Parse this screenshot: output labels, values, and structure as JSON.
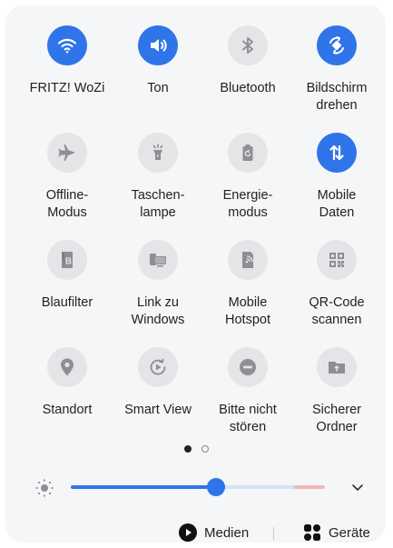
{
  "tiles": [
    {
      "label": "FRITZ! WoZi",
      "icon": "wifi-icon",
      "state": "on"
    },
    {
      "label": "Ton",
      "icon": "sound-icon",
      "state": "on"
    },
    {
      "label": "Bluetooth",
      "icon": "bluetooth-icon",
      "state": "off"
    },
    {
      "label": "Bildschirm\ndrehen",
      "icon": "auto-rotate-icon",
      "state": "on"
    },
    {
      "label": "Offline-\nModus",
      "icon": "airplane-icon",
      "state": "off"
    },
    {
      "label": "Taschen-\nlampe",
      "icon": "flashlight-icon",
      "state": "off"
    },
    {
      "label": "Energie-\nmodus",
      "icon": "power-saving-icon",
      "state": "off"
    },
    {
      "label": "Mobile\nDaten",
      "icon": "mobile-data-icon",
      "state": "on"
    },
    {
      "label": "Blaufilter",
      "icon": "blue-light-filter-icon",
      "state": "off"
    },
    {
      "label": "Link zu\nWindows",
      "icon": "link-to-windows-icon",
      "state": "off"
    },
    {
      "label": "Mobile\nHotspot",
      "icon": "hotspot-icon",
      "state": "off"
    },
    {
      "label": "QR-Code\nscannen",
      "icon": "qr-code-icon",
      "state": "off"
    },
    {
      "label": "Standort",
      "icon": "location-icon",
      "state": "off"
    },
    {
      "label": "Smart View",
      "icon": "smart-view-icon",
      "state": "off"
    },
    {
      "label": "Bitte nicht\nstören",
      "icon": "do-not-disturb-icon",
      "state": "off"
    },
    {
      "label": "Sicherer\nOrdner",
      "icon": "secure-folder-icon",
      "state": "off"
    }
  ],
  "pager": {
    "pages": 2,
    "current": 1
  },
  "brightness": {
    "level": 0.57
  },
  "footer": {
    "media_label": "Medien",
    "devices_label": "Geräte"
  },
  "colors": {
    "accent": "#2f74e8",
    "inactive_bg": "#e4e5e7",
    "inactive_icon": "#8e8f93",
    "panel": "#f5f6f8"
  }
}
